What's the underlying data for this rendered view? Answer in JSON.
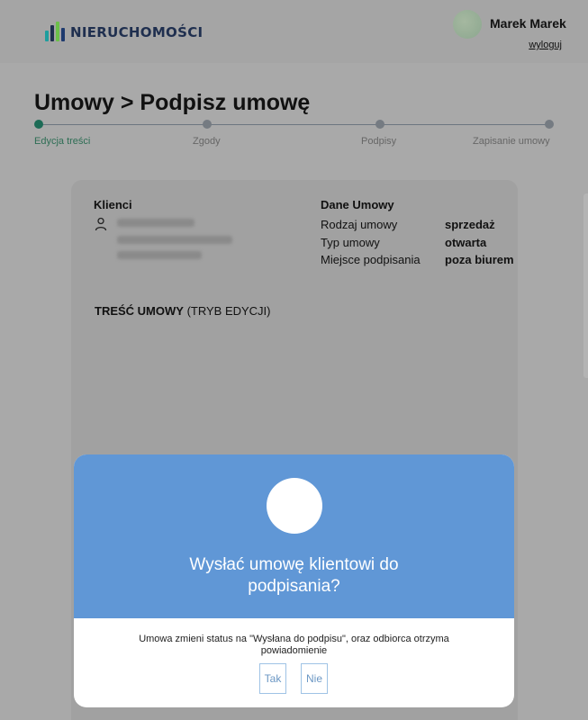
{
  "header": {
    "logo_text": "NIERUCHOMOŚCI",
    "logo_colors": [
      "#1e9e9e",
      "#1f2f4f",
      "#6cc04a",
      "#1e3a6e"
    ],
    "user_name": "Marek Marek",
    "logout_label": "wyloguj"
  },
  "page": {
    "title_prefix": "Umowy > ",
    "title_main": "Podpisz umowę"
  },
  "stepper": {
    "steps": [
      {
        "label": "Edycja treści",
        "active": true
      },
      {
        "label": "Zgody",
        "active": false
      },
      {
        "label": "Podpisy",
        "active": false
      },
      {
        "label": "Zapisanie umowy",
        "active": false
      }
    ]
  },
  "clients": {
    "title": "Klienci",
    "icon": "person-icon"
  },
  "contract": {
    "title": "Dane Umowy",
    "rows": [
      {
        "label": "Rodzaj umowy",
        "value": "sprzedaż"
      },
      {
        "label": "Typ umowy",
        "value": "otwarta"
      },
      {
        "label": "Miejsce podpisania",
        "value": "poza biurem"
      }
    ]
  },
  "content": {
    "title_bold": "TREŚĆ UMOWY",
    "title_suffix": " (TRYB EDYCJI)"
  },
  "modal": {
    "question": "Wysłać umowę klientowi do podpisania?",
    "message": "Umowa zmieni status na \"Wysłana do podpisu\", oraz odbiorca otrzyma powiadomienie",
    "yes_label": "Tak",
    "no_label": "Nie",
    "accent_color": "#6097d6"
  }
}
